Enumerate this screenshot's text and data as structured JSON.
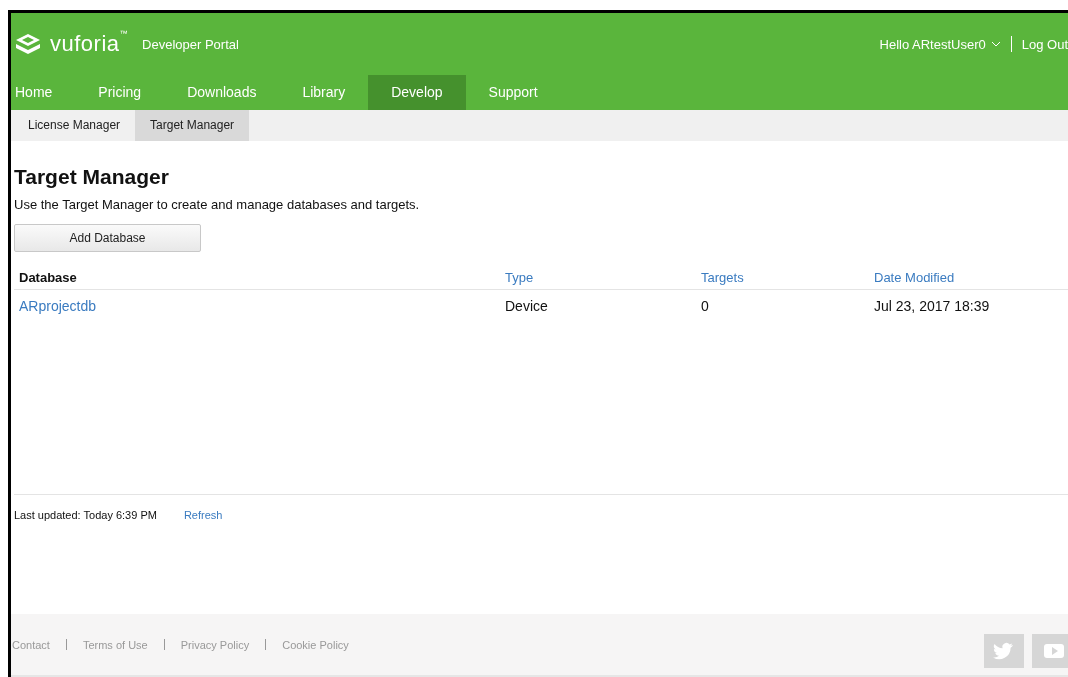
{
  "header": {
    "brand": "vuforia",
    "trademark": "™",
    "portal": "Developer Portal",
    "greeting": "Hello ARtestUser0",
    "logout": "Log Out"
  },
  "nav": [
    {
      "label": "Home",
      "selected": false
    },
    {
      "label": "Pricing",
      "selected": false
    },
    {
      "label": "Downloads",
      "selected": false
    },
    {
      "label": "Library",
      "selected": false
    },
    {
      "label": "Develop",
      "selected": true
    },
    {
      "label": "Support",
      "selected": false
    }
  ],
  "subnav": [
    {
      "label": "License Manager",
      "selected": false
    },
    {
      "label": "Target Manager",
      "selected": true
    }
  ],
  "page": {
    "title": "Target Manager",
    "description": "Use the Target Manager to create and manage databases and targets.",
    "add_button": "Add Database"
  },
  "table": {
    "columns": [
      {
        "label": "Database",
        "sortable": false
      },
      {
        "label": "Type",
        "sortable": true
      },
      {
        "label": "Targets",
        "sortable": true
      },
      {
        "label": "Date Modified",
        "sortable": true
      }
    ],
    "rows": [
      {
        "cells": [
          "ARprojectdb",
          "Device",
          "0",
          "Jul 23, 2017 18:39"
        ]
      }
    ]
  },
  "status": {
    "last_updated": "Last updated: Today 6:39 PM",
    "refresh": "Refresh"
  },
  "footer": {
    "links": [
      "Contact",
      "Terms of Use",
      "Privacy Policy",
      "Cookie Policy"
    ]
  }
}
